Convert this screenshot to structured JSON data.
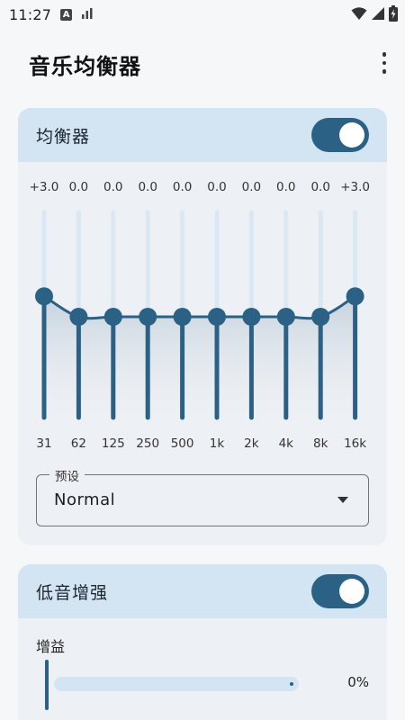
{
  "status_bar": {
    "time": "11:27",
    "notif_icon": "A"
  },
  "app": {
    "title": "音乐均衡器"
  },
  "equalizer": {
    "title": "均衡器",
    "enabled": true,
    "bands": [
      {
        "freq": "31",
        "gain_label": "+3.0",
        "gain": 3.0
      },
      {
        "freq": "62",
        "gain_label": "0.0",
        "gain": 0.0
      },
      {
        "freq": "125",
        "gain_label": "0.0",
        "gain": 0.0
      },
      {
        "freq": "250",
        "gain_label": "0.0",
        "gain": 0.0
      },
      {
        "freq": "500",
        "gain_label": "0.0",
        "gain": 0.0
      },
      {
        "freq": "1k",
        "gain_label": "0.0",
        "gain": 0.0
      },
      {
        "freq": "2k",
        "gain_label": "0.0",
        "gain": 0.0
      },
      {
        "freq": "4k",
        "gain_label": "0.0",
        "gain": 0.0
      },
      {
        "freq": "8k",
        "gain_label": "0.0",
        "gain": 0.0
      },
      {
        "freq": "16k",
        "gain_label": "+3.0",
        "gain": 3.0
      }
    ],
    "preset_label": "预设",
    "preset_value": "Normal"
  },
  "bass": {
    "title": "低音增强",
    "enabled": true,
    "gain_label": "增益",
    "value_label": "0%",
    "value": 0
  },
  "colors": {
    "accent": "#2b6185",
    "header_bg": "#d3e5f3",
    "card_bg": "#edf0f4",
    "track": "#dbe8f3"
  }
}
